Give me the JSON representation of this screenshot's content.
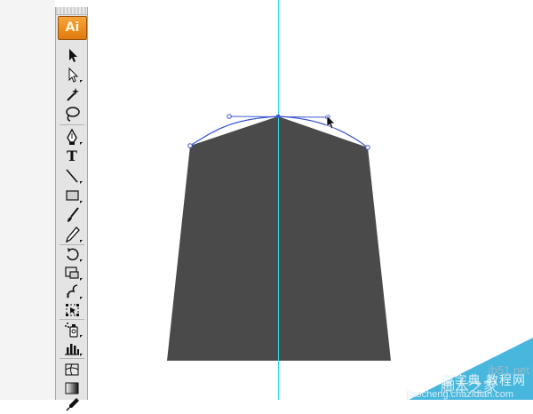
{
  "app": {
    "logo_text": "Ai"
  },
  "toolbar": {
    "tools": [
      {
        "name": "selection-tool-icon"
      },
      {
        "name": "direct-selection-tool-icon"
      },
      {
        "name": "magic-wand-tool-icon"
      },
      {
        "name": "lasso-tool-icon"
      },
      {
        "name": "pen-tool-icon"
      },
      {
        "name": "type-tool-icon",
        "label": "T"
      },
      {
        "name": "line-segment-tool-icon"
      },
      {
        "name": "rectangle-tool-icon"
      },
      {
        "name": "paintbrush-tool-icon"
      },
      {
        "name": "pencil-tool-icon"
      },
      {
        "name": "rotate-tool-icon"
      },
      {
        "name": "scale-tool-icon"
      },
      {
        "name": "warp-tool-icon"
      },
      {
        "name": "free-transform-tool-icon"
      },
      {
        "name": "symbol-sprayer-tool-icon"
      },
      {
        "name": "column-graph-tool-icon"
      },
      {
        "name": "mesh-tool-icon"
      },
      {
        "name": "gradient-tool-icon"
      },
      {
        "name": "eyedropper-tool-icon"
      }
    ]
  },
  "canvas": {
    "shape_fill": "#4a4a4a",
    "guide_color": "#37d5e0",
    "path_color": "#3a56d4"
  },
  "watermark": {
    "line1": "查字典",
    "line2": "教程网",
    "site": "jb51.net",
    "line3": "脚本之家",
    "url": "jiaocheng.chazidian.com"
  }
}
